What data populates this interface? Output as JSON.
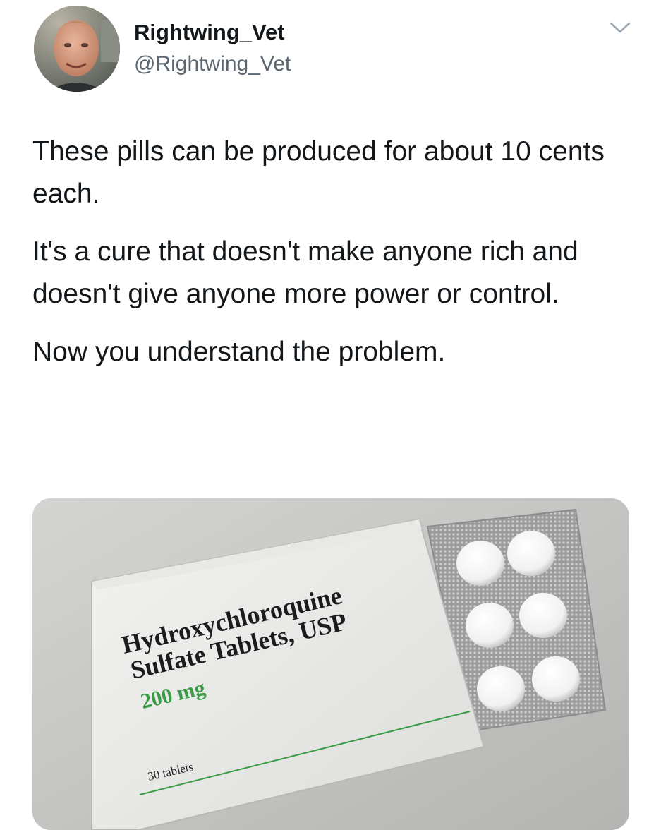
{
  "user": {
    "display_name": "Rightwing_Vet",
    "handle": "@Rightwing_Vet"
  },
  "icons": {
    "avatar": "profile-photo",
    "menu": "chevron-down-icon"
  },
  "tweet": {
    "paragraphs": [
      "These pills can be produced for about 10 cents each.",
      "It's a cure that doesn't make anyone rich and doesn't give anyone more power or control.",
      "Now you understand the problem."
    ]
  },
  "media": {
    "box_line_1": "Hydroxychloroquine",
    "box_line_2": "Sulfate Tablets, USP",
    "dose": "200 mg",
    "count": "30 tablets",
    "accent_color": "#3a9b46"
  }
}
